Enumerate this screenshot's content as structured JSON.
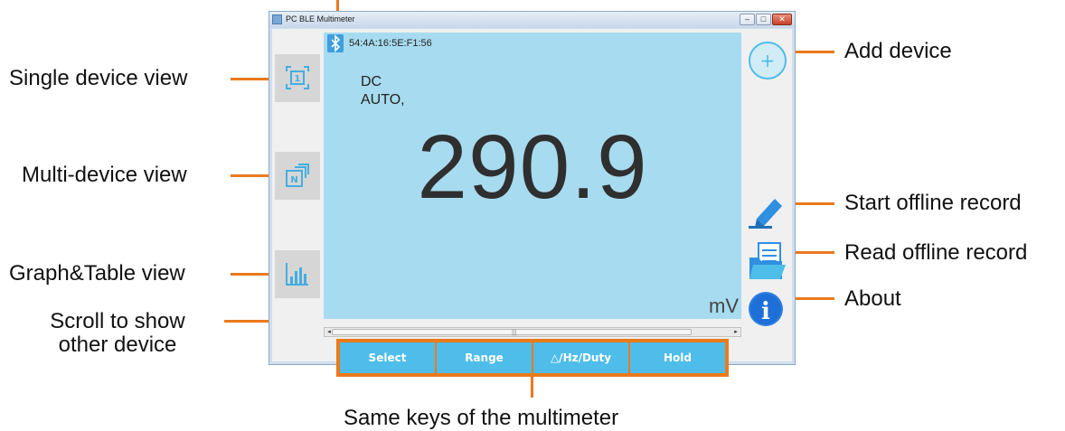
{
  "window": {
    "title": "PC BLE Multimeter",
    "min_glyph": "–",
    "max_glyph": "□",
    "close_glyph": "✕"
  },
  "device": {
    "mac_address": "54:4A:16:5E:F1:56",
    "mode_line1": "DC",
    "mode_line2": "AUTO,",
    "reading": "290.9",
    "unit": "mV"
  },
  "left_rail": {
    "single_view_glyph": "1",
    "multi_view_glyph": "N"
  },
  "keys": [
    "Select",
    "Range",
    "△/Hz/Duty",
    "Hold"
  ],
  "right_rail": {
    "add_glyph": "+",
    "about_glyph": "i"
  },
  "scroll": {
    "left_arrow": "◂",
    "right_arrow": "▸",
    "grip": "|||"
  },
  "callouts": {
    "single_view": "Single device view",
    "multi_view": "Multi-device view",
    "graph_view": "Graph&Table view",
    "scroll_line1": "Scroll to show",
    "scroll_line2": "other device",
    "add_device": "Add device",
    "start_record": "Start offline record",
    "read_record": "Read offline record",
    "about": "About",
    "same_keys": "Same keys of the multimeter"
  },
  "colors": {
    "accent_orange": "#ea7a1c",
    "display_bg": "#a7dbef",
    "key_bg": "#4ebde9",
    "bluetooth_blue": "#3f9de0"
  }
}
